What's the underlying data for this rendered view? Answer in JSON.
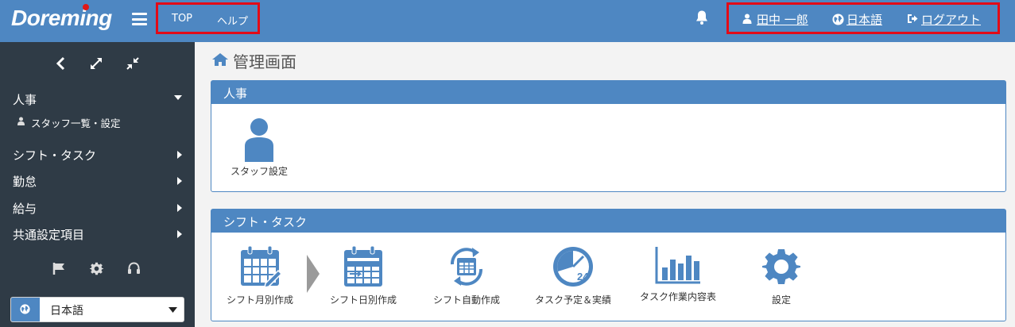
{
  "header": {
    "logo": "Doreming",
    "nav": {
      "top": "TOP",
      "help": "ヘルプ"
    },
    "user_name": "田中 一郎",
    "language": "日本語",
    "logout": "ログアウト"
  },
  "sidebar": {
    "menu": [
      {
        "label": "人事",
        "expanded": true
      },
      {
        "label": "シフト・タスク",
        "expanded": false
      },
      {
        "label": "勤怠",
        "expanded": false
      },
      {
        "label": "給与",
        "expanded": false
      },
      {
        "label": "共通設定項目",
        "expanded": false
      }
    ],
    "sub_item": "スタッフ一覧・設定",
    "language_select": "日本語"
  },
  "main": {
    "title": "管理画面",
    "panels": [
      {
        "title": "人事",
        "tiles": [
          {
            "label": "スタッフ設定",
            "icon": "user-icon"
          }
        ]
      },
      {
        "title": "シフト・タスク",
        "tiles": [
          {
            "label": "シフト月別作成",
            "icon": "calendar-edit-icon"
          },
          {
            "label": "シフト日別作成",
            "icon": "calendar-grid-icon"
          },
          {
            "label": "シフト自動作成",
            "icon": "calendar-refresh-icon"
          },
          {
            "label": "タスク予定＆実績",
            "icon": "clock-24-icon"
          },
          {
            "label": "タスク作業内容表",
            "icon": "bar-chart-icon"
          },
          {
            "label": "設定",
            "icon": "gear-icon"
          }
        ]
      }
    ]
  },
  "colors": {
    "brand": "#4e87c2",
    "sidebar": "#2f3b46",
    "highlight_border": "#e30b17",
    "icon": "#4e87c2"
  }
}
